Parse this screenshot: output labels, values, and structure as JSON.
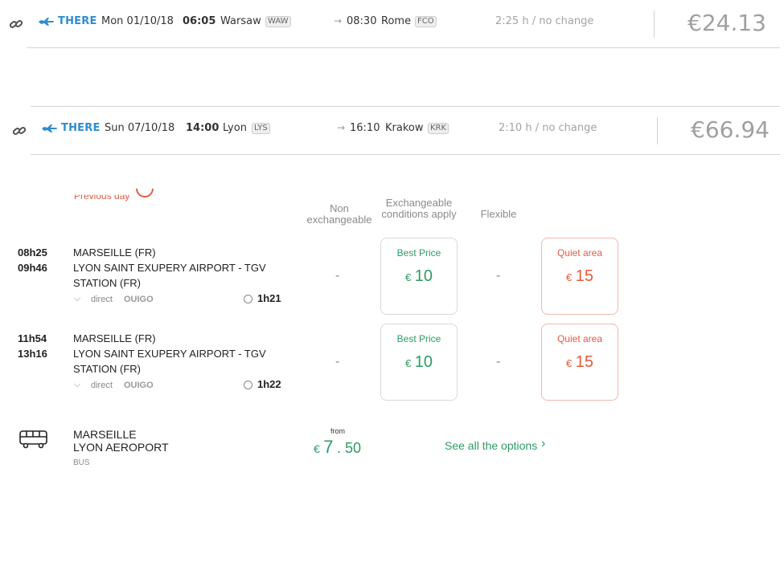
{
  "flights": [
    {
      "label": "THERE",
      "date": "Mon 01/10/18",
      "dep_time": "06:05",
      "dep_city": "Warsaw",
      "dep_code": "WAW",
      "arr_time": "08:30",
      "arr_city": "Rome",
      "arr_code": "FCO",
      "duration": "2:25 h / no change",
      "price": "€24.13"
    },
    {
      "label": "THERE",
      "date": "Sun 07/10/18",
      "dep_time": "14:00",
      "dep_city": "Lyon",
      "dep_code": "LYS",
      "arr_time": "16:10",
      "arr_city": "Krakow",
      "arr_code": "KRK",
      "duration": "2:10 h / no change",
      "price": "€66.94"
    }
  ],
  "train": {
    "previous_day": "Previous day",
    "columns": {
      "non_exchangeable": "Non exchangeable",
      "exchangeable": "Exchangeable conditions apply",
      "flexible": "Flexible"
    },
    "rows": [
      {
        "dep_time": "08h25",
        "arr_time": "09h46",
        "origin": "MARSEILLE (FR)",
        "destination": "LYON SAINT EXUPERY AIRPORT - TGV STATION (FR)",
        "direct": "direct",
        "operator": "OUIGO",
        "duration": "1h21",
        "non_exchangeable": "-",
        "exchangeable_label": "Best Price",
        "exchangeable_currency": "€",
        "exchangeable_price": "10",
        "flexible": "-",
        "quiet_label": "Quiet area",
        "quiet_currency": "€",
        "quiet_price": "15"
      },
      {
        "dep_time": "11h54",
        "arr_time": "13h16",
        "origin": "MARSEILLE (FR)",
        "destination": "LYON SAINT EXUPERY AIRPORT - TGV STATION (FR)",
        "direct": "direct",
        "operator": "OUIGO",
        "duration": "1h22",
        "non_exchangeable": "-",
        "exchangeable_label": "Best Price",
        "exchangeable_currency": "€",
        "exchangeable_price": "10",
        "flexible": "-",
        "quiet_label": "Quiet area",
        "quiet_currency": "€",
        "quiet_price": "15"
      }
    ]
  },
  "bus": {
    "origin": "MARSEILLE",
    "destination": "LYON AEROPORT",
    "mode": "BUS",
    "from_label": "from",
    "currency": "€",
    "price_int": "7",
    "price_dec": ". 50",
    "see_all": "See all the options"
  },
  "colors": {
    "accent_blue": "#2f8ccf",
    "price_green": "#2c9c63",
    "price_red": "#e35b3c"
  }
}
